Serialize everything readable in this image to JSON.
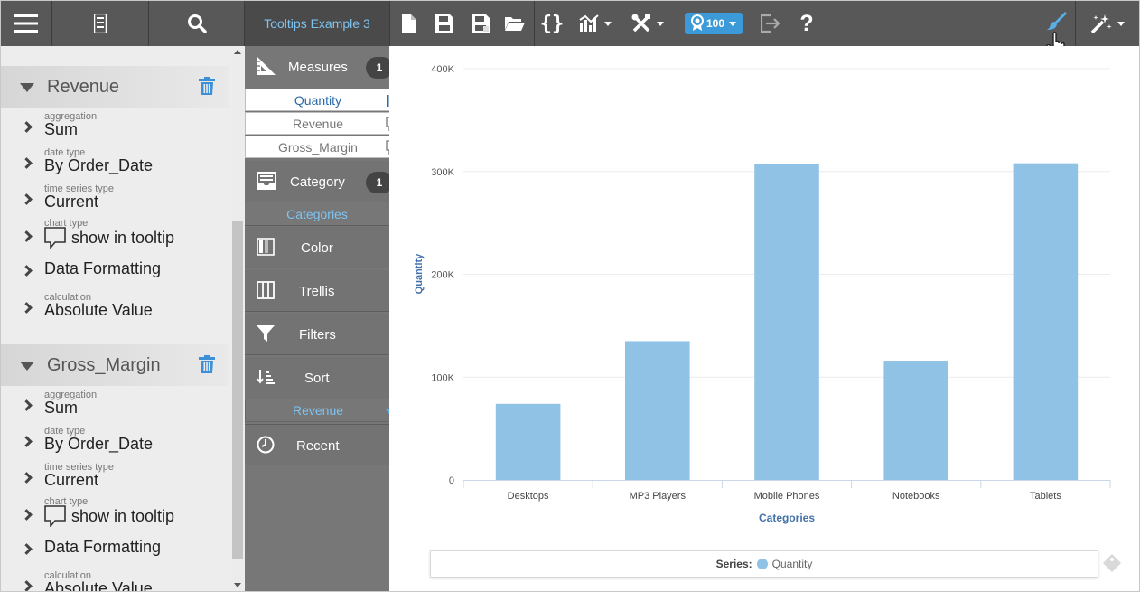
{
  "toolbar": {
    "tab_title": "Tooltips Example 3",
    "badge_value": "100",
    "help_label": "?",
    "icons": [
      "hamburger-icon",
      "document-icon",
      "search-icon",
      "new-file-icon",
      "save-icon",
      "save-as-icon",
      "open-folder-icon",
      "braces-icon",
      "chart-type-icon",
      "tools-icon",
      "award-icon",
      "exit-icon",
      "help-icon",
      "brush-icon",
      "magic-wand-icon"
    ]
  },
  "left_panel": {
    "sections": [
      {
        "title": "Revenue",
        "props": [
          {
            "label": "aggregation",
            "value": "Sum"
          },
          {
            "label": "date type",
            "value": "By Order_Date"
          },
          {
            "label": "time series type",
            "value": "Current"
          },
          {
            "label": "chart type",
            "value": "show in tooltip"
          },
          {
            "label": "",
            "value": "Data Formatting"
          },
          {
            "label": "calculation",
            "value": "Absolute Value"
          }
        ]
      },
      {
        "title": "Gross_Margin",
        "props": [
          {
            "label": "aggregation",
            "value": "Sum"
          },
          {
            "label": "date type",
            "value": "By Order_Date"
          },
          {
            "label": "time series type",
            "value": "Current"
          },
          {
            "label": "chart type",
            "value": "show in tooltip"
          },
          {
            "label": "",
            "value": "Data Formatting"
          },
          {
            "label": "calculation",
            "value": "Absolute Value"
          }
        ]
      }
    ]
  },
  "fields_panel": {
    "measures": {
      "label": "Measures",
      "count": "1",
      "items": [
        "Quantity",
        "Revenue",
        "Gross_Margin"
      ]
    },
    "category": {
      "label": "Category",
      "count": "1",
      "item": "Categories"
    },
    "color": {
      "label": "Color"
    },
    "trellis": {
      "label": "Trellis"
    },
    "filters": {
      "label": "Filters"
    },
    "sort": {
      "label": "Sort",
      "item": "Revenue"
    },
    "recent": {
      "label": "Recent"
    }
  },
  "chart_data": {
    "type": "bar",
    "categories": [
      "Desktops",
      "MP3 Players",
      "Mobile Phones",
      "Notebooks",
      "Tablets"
    ],
    "series": [
      {
        "name": "Quantity",
        "values": [
          74000,
          135000,
          307000,
          116000,
          308000
        ]
      }
    ],
    "xlabel": "Categories",
    "ylabel": "Quantity",
    "ylim": [
      0,
      400000
    ],
    "yticks": [
      "0",
      "100K",
      "200K",
      "300K",
      "400K"
    ],
    "grid": true,
    "legend": {
      "title": "Series:",
      "position": "bottom"
    },
    "colors": {
      "bar": "#90c2e6",
      "axis_title": "#4472a8"
    }
  }
}
